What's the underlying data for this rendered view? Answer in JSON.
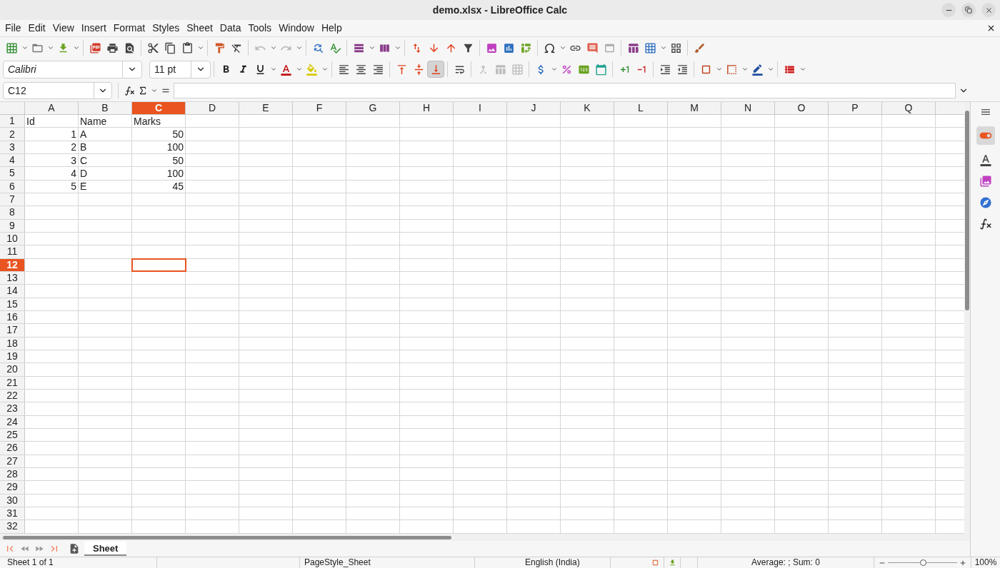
{
  "window": {
    "title": "demo.xlsx - LibreOffice Calc"
  },
  "menu": [
    "File",
    "Edit",
    "View",
    "Insert",
    "Format",
    "Styles",
    "Sheet",
    "Data",
    "Tools",
    "Window",
    "Help"
  ],
  "standard_toolbar": {
    "undo_disabled": true,
    "redo_disabled": true
  },
  "formatting_toolbar": {
    "font": "Calibri",
    "size": "11 pt",
    "vertical_align": [
      {
        "kind": "top",
        "selected": false
      },
      {
        "kind": "center",
        "selected": false
      },
      {
        "kind": "bottom",
        "selected": true
      }
    ],
    "merge_disabled": true
  },
  "name_box": "C12",
  "columns": [
    {
      "label": "A",
      "selected": false
    },
    {
      "label": "B",
      "selected": false
    },
    {
      "label": "C",
      "selected": true
    },
    {
      "label": "D",
      "selected": false
    },
    {
      "label": "E",
      "selected": false
    },
    {
      "label": "F",
      "selected": false
    },
    {
      "label": "G",
      "selected": false
    },
    {
      "label": "H",
      "selected": false
    },
    {
      "label": "I",
      "selected": false
    },
    {
      "label": "J",
      "selected": false
    },
    {
      "label": "K",
      "selected": false
    },
    {
      "label": "L",
      "selected": false
    },
    {
      "label": "M",
      "selected": false
    },
    {
      "label": "N",
      "selected": false
    },
    {
      "label": "O",
      "selected": false
    },
    {
      "label": "P",
      "selected": false
    },
    {
      "label": "Q",
      "selected": false
    }
  ],
  "rows": [
    {
      "label": "1",
      "selected": false,
      "cells": [
        {
          "text": "Id",
          "kind": "text"
        },
        {
          "text": "Name",
          "kind": "text"
        },
        {
          "text": "Marks",
          "kind": "text"
        }
      ]
    },
    {
      "label": "2",
      "selected": false,
      "cells": [
        {
          "text": "1",
          "kind": "number"
        },
        {
          "text": "A",
          "kind": "text"
        },
        {
          "text": "50",
          "kind": "number"
        }
      ]
    },
    {
      "label": "3",
      "selected": false,
      "cells": [
        {
          "text": "2",
          "kind": "number"
        },
        {
          "text": "B",
          "kind": "text"
        },
        {
          "text": "100",
          "kind": "number"
        }
      ]
    },
    {
      "label": "4",
      "selected": false,
      "cells": [
        {
          "text": "3",
          "kind": "number"
        },
        {
          "text": "C",
          "kind": "text"
        },
        {
          "text": "50",
          "kind": "number"
        }
      ]
    },
    {
      "label": "5",
      "selected": false,
      "cells": [
        {
          "text": "4",
          "kind": "number"
        },
        {
          "text": "D",
          "kind": "text"
        },
        {
          "text": "100",
          "kind": "number"
        }
      ]
    },
    {
      "label": "6",
      "selected": false,
      "cells": [
        {
          "text": "5",
          "kind": "number"
        },
        {
          "text": "E",
          "kind": "text"
        },
        {
          "text": "45",
          "kind": "number"
        }
      ]
    },
    {
      "label": "7",
      "selected": false
    },
    {
      "label": "8",
      "selected": false
    },
    {
      "label": "9",
      "selected": false
    },
    {
      "label": "10",
      "selected": false
    },
    {
      "label": "11",
      "selected": false
    },
    {
      "label": "12",
      "selected": true
    },
    {
      "label": "13",
      "selected": false
    },
    {
      "label": "14",
      "selected": false
    },
    {
      "label": "15",
      "selected": false
    },
    {
      "label": "16",
      "selected": false
    },
    {
      "label": "17",
      "selected": false
    },
    {
      "label": "18",
      "selected": false
    },
    {
      "label": "19",
      "selected": false
    },
    {
      "label": "20",
      "selected": false
    },
    {
      "label": "21",
      "selected": false
    },
    {
      "label": "22",
      "selected": false
    },
    {
      "label": "23",
      "selected": false
    },
    {
      "label": "24",
      "selected": false
    },
    {
      "label": "25",
      "selected": false
    },
    {
      "label": "26",
      "selected": false
    },
    {
      "label": "27",
      "selected": false
    },
    {
      "label": "28",
      "selected": false
    },
    {
      "label": "29",
      "selected": false
    },
    {
      "label": "30",
      "selected": false
    },
    {
      "label": "31",
      "selected": false
    },
    {
      "label": "32",
      "selected": false
    }
  ],
  "sheet_tabs": [
    {
      "label": "Sheet",
      "selected": true
    }
  ],
  "status_bar": {
    "sheet": "Sheet 1 of 1",
    "page_style": "PageStyle_Sheet",
    "language": "English (India)",
    "summary": "Average: ; Sum: 0",
    "zoom": {
      "level": 0.5,
      "reading": "100%"
    }
  }
}
